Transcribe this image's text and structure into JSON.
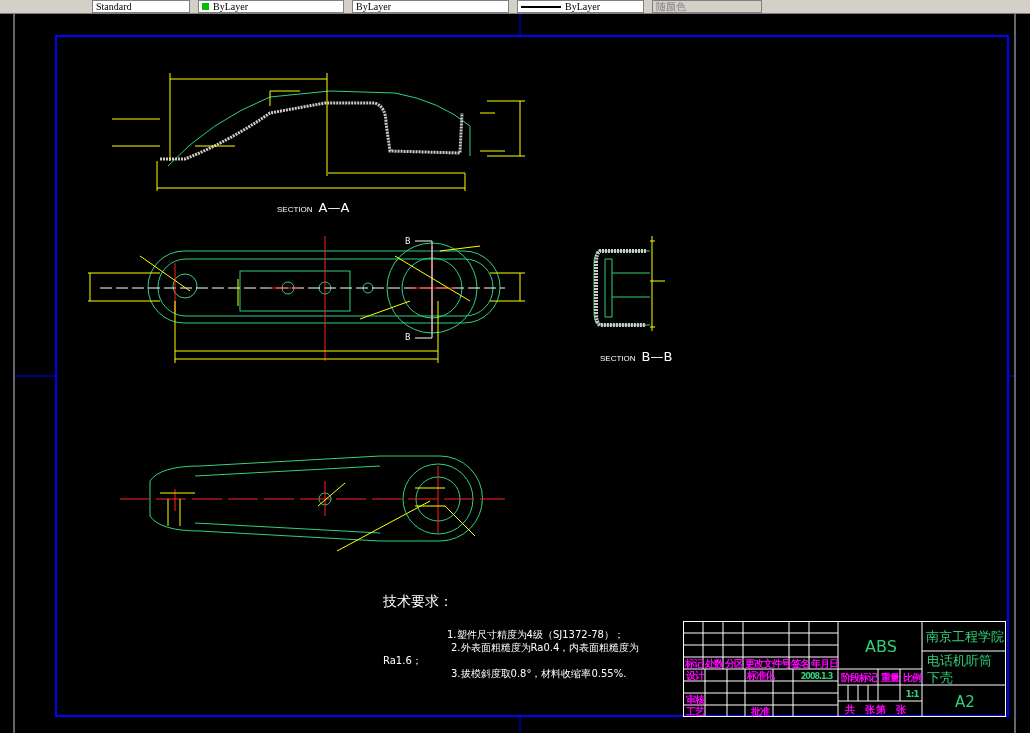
{
  "toolbar": {
    "dropdowns": [
      {
        "kind": "style",
        "value": "Standard",
        "disabled": false
      },
      {
        "kind": "color",
        "value": "ByLayer",
        "disabled": false
      },
      {
        "kind": "linetype",
        "value": "ByLayer",
        "disabled": false
      },
      {
        "kind": "lineweight",
        "value": "ByLayer",
        "disabled": false
      },
      {
        "kind": "plotstyle",
        "value": "随颜色",
        "disabled": true
      }
    ]
  },
  "drawing": {
    "views": [
      {
        "kind": "section",
        "label": "SECTION",
        "name": "A—A"
      },
      {
        "kind": "section",
        "label": "SECTION",
        "name": "B—B"
      }
    ],
    "cut_marks": [
      "B",
      "B"
    ]
  },
  "technical_requirements": {
    "heading": "技术要求：",
    "lines": [
      "1.塑件尺寸精度为4级（SJ1372-78）；",
      "2.外表面粗糙度为Ra0.4，内表面粗糙度为",
      "Ra1.6；",
      "3.拔模斜度取0.8°，材料收缩率0.55%."
    ]
  },
  "title_block": {
    "headers": [
      "标记",
      "处数",
      "分区",
      "更改文件号",
      "签名",
      "年月日",
      "设计",
      "标准化",
      "审核",
      "工艺",
      "批准",
      "阶段标记",
      "重量",
      "比例",
      "共",
      "张 第",
      "张"
    ],
    "date": "2008.1.3",
    "scale": "1:1",
    "material": "ABS",
    "school": "南京工程学院",
    "part_name": [
      "电话机听筒",
      "下壳"
    ],
    "sheet_size": "A2"
  }
}
